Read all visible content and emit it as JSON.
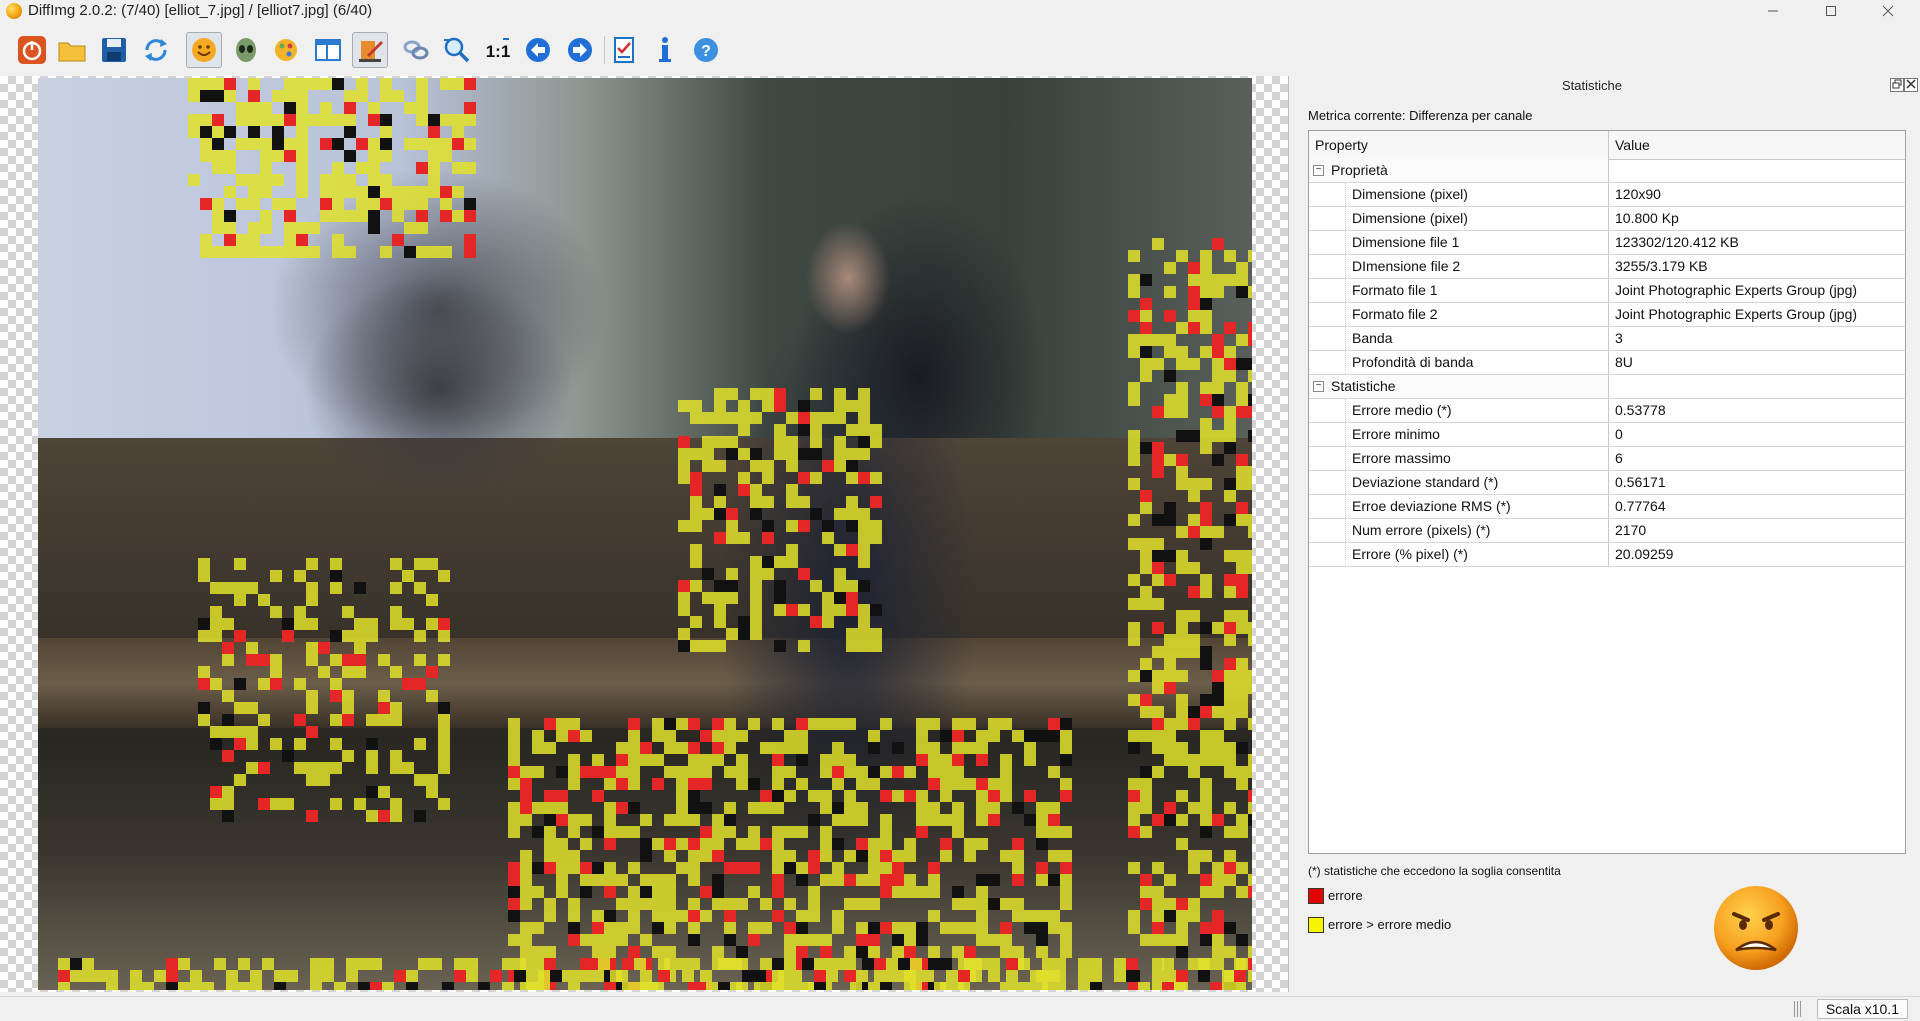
{
  "window": {
    "title": "DiffImg 2.0.2:  (7/40) [elliot_7.jpg] / [elliot7.jpg] (6/40)",
    "minimize_icon": "minimize-icon",
    "maximize_icon": "maximize-icon",
    "close_icon": "close-icon"
  },
  "toolbar": {
    "buttons": [
      {
        "name": "quit",
        "icon": "power-icon",
        "active": false
      },
      {
        "name": "open",
        "icon": "folder-icon",
        "active": false
      },
      {
        "name": "save",
        "icon": "floppy-icon",
        "active": false
      },
      {
        "name": "refresh",
        "icon": "refresh-icon",
        "active": false
      },
      {
        "name": "smiley",
        "icon": "smiley-icon",
        "active": true
      },
      {
        "name": "alien",
        "icon": "alien-icon",
        "active": false
      },
      {
        "name": "palette",
        "icon": "palette-icon",
        "active": false
      },
      {
        "name": "layout",
        "icon": "panel-icon",
        "active": false
      },
      {
        "name": "pen",
        "icon": "pen-icon",
        "active": true
      },
      {
        "name": "link",
        "icon": "link-icon",
        "active": false
      },
      {
        "name": "zoom",
        "icon": "zoom-icon",
        "active": false
      },
      {
        "name": "zoom-1-1",
        "icon": "one-to-one-icon",
        "label": "1:1",
        "active": false
      },
      {
        "name": "previous",
        "icon": "arrow-left-icon",
        "active": false
      },
      {
        "name": "next",
        "icon": "arrow-right-icon",
        "active": false
      },
      {
        "name": "checklist",
        "icon": "checklist-icon",
        "active": false
      },
      {
        "name": "info",
        "icon": "info-icon",
        "active": false
      },
      {
        "name": "help",
        "icon": "help-icon",
        "active": false
      }
    ]
  },
  "panel": {
    "title": "Statistiche",
    "metric_label": "Metrica corrente: Differenza per canale",
    "columns": [
      "Property",
      "Value"
    ],
    "groups": [
      {
        "label": "Proprietà",
        "rows": [
          {
            "property": "Dimensione (pixel)",
            "value": "120x90"
          },
          {
            "property": "Dimensione (pixel)",
            "value": "10.800 Kp"
          },
          {
            "property": "Dimensione file 1",
            "value": "123302/120.412 KB"
          },
          {
            "property": "DImensione file 2",
            "value": "3255/3.179 KB"
          },
          {
            "property": "Formato file 1",
            "value": "Joint Photographic Experts Group (jpg)"
          },
          {
            "property": "Formato file 2",
            "value": "Joint Photographic Experts Group (jpg)"
          },
          {
            "property": "Banda",
            "value": "3"
          },
          {
            "property": "Profondità di banda",
            "value": "8U"
          }
        ]
      },
      {
        "label": "Statistiche",
        "rows": [
          {
            "property": "Errore medio (*)",
            "value": "0.53778"
          },
          {
            "property": "Errore minimo",
            "value": "0"
          },
          {
            "property": "Errore massimo",
            "value": "6"
          },
          {
            "property": "Deviazione standard (*)",
            "value": "0.56171"
          },
          {
            "property": "Erroe deviazione RMS (*)",
            "value": "0.77764"
          },
          {
            "property": "Num errore (pixels) (*)",
            "value": "2170"
          },
          {
            "property": "Errore (% pixel) (*)",
            "value": "20.09259"
          }
        ]
      }
    ],
    "note": "(*) statistiche che eccedono la soglia consentita",
    "legend": [
      {
        "label": "errore",
        "color": "#e00000"
      },
      {
        "label": "errore > errore medio",
        "color": "#f5f500"
      }
    ],
    "status_icon": "angry-face-icon"
  },
  "statusbar": {
    "scale": "Scala x10.1"
  },
  "colors": {
    "error": "#e42626",
    "above_mean": "#e2e22a",
    "window_bg": "#f0f0f0"
  }
}
